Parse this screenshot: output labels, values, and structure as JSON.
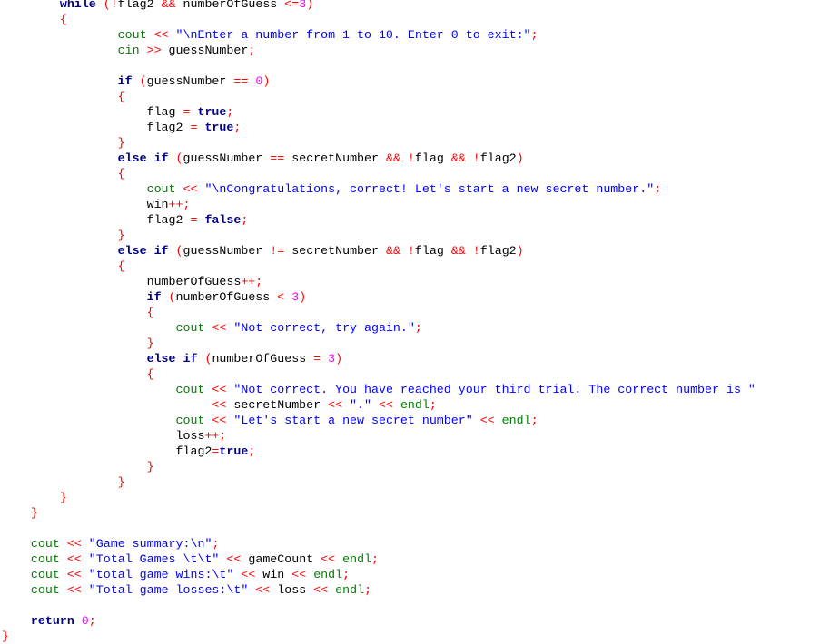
{
  "editor": {
    "language": "cpp",
    "colors": {
      "keyword": "#00008b",
      "stream": "#008000",
      "string": "#0000ff",
      "operator": "#ff0000",
      "number": "#ff00ff",
      "identifier": "#000000"
    },
    "lines": [
      {
        "indent": 8,
        "tokens": [
          [
            "kw",
            "while"
          ],
          [
            "id",
            " "
          ],
          [
            "op",
            "(!"
          ],
          [
            "id",
            "flag2 "
          ],
          [
            "op",
            "&&"
          ],
          [
            "id",
            " numberOfGuess "
          ],
          [
            "op",
            "<="
          ],
          [
            "num",
            "3"
          ],
          [
            "op",
            ")"
          ]
        ]
      },
      {
        "indent": 8,
        "tokens": [
          [
            "op",
            "{"
          ]
        ]
      },
      {
        "indent": 16,
        "tokens": [
          [
            "fn",
            "cout"
          ],
          [
            "id",
            " "
          ],
          [
            "op",
            "<<"
          ],
          [
            "id",
            " "
          ],
          [
            "str",
            "\"\\nEnter a number from 1 to 10. Enter 0 to exit:\""
          ],
          [
            "op",
            ";"
          ]
        ]
      },
      {
        "indent": 16,
        "tokens": [
          [
            "fn",
            "cin"
          ],
          [
            "id",
            " "
          ],
          [
            "op",
            ">>"
          ],
          [
            "id",
            " guessNumber"
          ],
          [
            "op",
            ";"
          ]
        ]
      },
      {
        "indent": 0,
        "tokens": []
      },
      {
        "indent": 16,
        "tokens": [
          [
            "kw",
            "if"
          ],
          [
            "id",
            " "
          ],
          [
            "op",
            "("
          ],
          [
            "id",
            "guessNumber "
          ],
          [
            "op",
            "=="
          ],
          [
            "id",
            " "
          ],
          [
            "num",
            "0"
          ],
          [
            "op",
            ")"
          ]
        ]
      },
      {
        "indent": 16,
        "tokens": [
          [
            "op",
            "{"
          ]
        ]
      },
      {
        "indent": 20,
        "tokens": [
          [
            "id",
            "flag "
          ],
          [
            "op",
            "="
          ],
          [
            "id",
            " "
          ],
          [
            "kw",
            "true"
          ],
          [
            "op",
            ";"
          ]
        ]
      },
      {
        "indent": 20,
        "tokens": [
          [
            "id",
            "flag2 "
          ],
          [
            "op",
            "="
          ],
          [
            "id",
            " "
          ],
          [
            "kw",
            "true"
          ],
          [
            "op",
            ";"
          ]
        ]
      },
      {
        "indent": 16,
        "tokens": [
          [
            "op",
            "}"
          ]
        ]
      },
      {
        "indent": 16,
        "tokens": [
          [
            "kw",
            "else"
          ],
          [
            "id",
            " "
          ],
          [
            "kw",
            "if"
          ],
          [
            "id",
            " "
          ],
          [
            "op",
            "("
          ],
          [
            "id",
            "guessNumber "
          ],
          [
            "op",
            "=="
          ],
          [
            "id",
            " secretNumber "
          ],
          [
            "op",
            "&&"
          ],
          [
            "id",
            " "
          ],
          [
            "op",
            "!"
          ],
          [
            "id",
            "flag "
          ],
          [
            "op",
            "&&"
          ],
          [
            "id",
            " "
          ],
          [
            "op",
            "!"
          ],
          [
            "id",
            "flag2"
          ],
          [
            "op",
            ")"
          ]
        ]
      },
      {
        "indent": 16,
        "tokens": [
          [
            "op",
            "{"
          ]
        ]
      },
      {
        "indent": 20,
        "tokens": [
          [
            "fn",
            "cout"
          ],
          [
            "id",
            " "
          ],
          [
            "op",
            "<<"
          ],
          [
            "id",
            " "
          ],
          [
            "str",
            "\"\\nCongratulations, correct! Let's start a new secret number.\""
          ],
          [
            "op",
            ";"
          ]
        ]
      },
      {
        "indent": 20,
        "tokens": [
          [
            "id",
            "win"
          ],
          [
            "op",
            "++;"
          ]
        ]
      },
      {
        "indent": 20,
        "tokens": [
          [
            "id",
            "flag2 "
          ],
          [
            "op",
            "="
          ],
          [
            "id",
            " "
          ],
          [
            "kw",
            "false"
          ],
          [
            "op",
            ";"
          ]
        ]
      },
      {
        "indent": 16,
        "tokens": [
          [
            "op",
            "}"
          ]
        ]
      },
      {
        "indent": 16,
        "tokens": [
          [
            "kw",
            "else"
          ],
          [
            "id",
            " "
          ],
          [
            "kw",
            "if"
          ],
          [
            "id",
            " "
          ],
          [
            "op",
            "("
          ],
          [
            "id",
            "guessNumber "
          ],
          [
            "op",
            "!="
          ],
          [
            "id",
            " secretNumber "
          ],
          [
            "op",
            "&&"
          ],
          [
            "id",
            " "
          ],
          [
            "op",
            "!"
          ],
          [
            "id",
            "flag "
          ],
          [
            "op",
            "&&"
          ],
          [
            "id",
            " "
          ],
          [
            "op",
            "!"
          ],
          [
            "id",
            "flag2"
          ],
          [
            "op",
            ")"
          ]
        ]
      },
      {
        "indent": 16,
        "tokens": [
          [
            "op",
            "{"
          ]
        ]
      },
      {
        "indent": 20,
        "tokens": [
          [
            "id",
            "numberOfGuess"
          ],
          [
            "op",
            "++;"
          ]
        ]
      },
      {
        "indent": 20,
        "tokens": [
          [
            "kw",
            "if"
          ],
          [
            "id",
            " "
          ],
          [
            "op",
            "("
          ],
          [
            "id",
            "numberOfGuess "
          ],
          [
            "op",
            "<"
          ],
          [
            "id",
            " "
          ],
          [
            "num",
            "3"
          ],
          [
            "op",
            ")"
          ]
        ]
      },
      {
        "indent": 20,
        "tokens": [
          [
            "op",
            "{"
          ]
        ]
      },
      {
        "indent": 24,
        "tokens": [
          [
            "fn",
            "cout"
          ],
          [
            "id",
            " "
          ],
          [
            "op",
            "<<"
          ],
          [
            "id",
            " "
          ],
          [
            "str",
            "\"Not correct, try again.\""
          ],
          [
            "op",
            ";"
          ]
        ]
      },
      {
        "indent": 20,
        "tokens": [
          [
            "op",
            "}"
          ]
        ]
      },
      {
        "indent": 20,
        "tokens": [
          [
            "kw",
            "else"
          ],
          [
            "id",
            " "
          ],
          [
            "kw",
            "if"
          ],
          [
            "id",
            " "
          ],
          [
            "op",
            "("
          ],
          [
            "id",
            "numberOfGuess "
          ],
          [
            "op",
            "="
          ],
          [
            "id",
            " "
          ],
          [
            "num",
            "3"
          ],
          [
            "op",
            ")"
          ]
        ]
      },
      {
        "indent": 20,
        "tokens": [
          [
            "op",
            "{"
          ]
        ]
      },
      {
        "indent": 24,
        "tokens": [
          [
            "fn",
            "cout"
          ],
          [
            "id",
            " "
          ],
          [
            "op",
            "<<"
          ],
          [
            "id",
            " "
          ],
          [
            "str",
            "\"Not correct. You have reached your third trial. The correct number is \""
          ]
        ]
      },
      {
        "indent": 29,
        "tokens": [
          [
            "op",
            "<<"
          ],
          [
            "id",
            " secretNumber "
          ],
          [
            "op",
            "<<"
          ],
          [
            "id",
            " "
          ],
          [
            "str",
            "\".\""
          ],
          [
            "id",
            " "
          ],
          [
            "op",
            "<<"
          ],
          [
            "id",
            " "
          ],
          [
            "fn",
            "endl"
          ],
          [
            "op",
            ";"
          ]
        ]
      },
      {
        "indent": 24,
        "tokens": [
          [
            "fn",
            "cout"
          ],
          [
            "id",
            " "
          ],
          [
            "op",
            "<<"
          ],
          [
            "id",
            " "
          ],
          [
            "str",
            "\"Let's start a new secret number\""
          ],
          [
            "id",
            " "
          ],
          [
            "op",
            "<<"
          ],
          [
            "id",
            " "
          ],
          [
            "fn",
            "endl"
          ],
          [
            "op",
            ";"
          ]
        ]
      },
      {
        "indent": 24,
        "tokens": [
          [
            "id",
            "loss"
          ],
          [
            "op",
            "++;"
          ]
        ]
      },
      {
        "indent": 24,
        "tokens": [
          [
            "id",
            "flag2"
          ],
          [
            "op",
            "="
          ],
          [
            "kw",
            "true"
          ],
          [
            "op",
            ";"
          ]
        ]
      },
      {
        "indent": 20,
        "tokens": [
          [
            "op",
            "}"
          ]
        ]
      },
      {
        "indent": 16,
        "tokens": [
          [
            "op",
            "}"
          ]
        ]
      },
      {
        "indent": 8,
        "tokens": [
          [
            "op",
            "}"
          ]
        ]
      },
      {
        "indent": 4,
        "tokens": [
          [
            "op",
            "}"
          ]
        ]
      },
      {
        "indent": 0,
        "tokens": []
      },
      {
        "indent": 4,
        "tokens": [
          [
            "fn",
            "cout"
          ],
          [
            "id",
            " "
          ],
          [
            "op",
            "<<"
          ],
          [
            "id",
            " "
          ],
          [
            "str",
            "\"Game summary:\\n\""
          ],
          [
            "op",
            ";"
          ]
        ]
      },
      {
        "indent": 4,
        "tokens": [
          [
            "fn",
            "cout"
          ],
          [
            "id",
            " "
          ],
          [
            "op",
            "<<"
          ],
          [
            "id",
            " "
          ],
          [
            "str",
            "\"Total Games \\t\\t\""
          ],
          [
            "id",
            " "
          ],
          [
            "op",
            "<<"
          ],
          [
            "id",
            " gameCount "
          ],
          [
            "op",
            "<<"
          ],
          [
            "id",
            " "
          ],
          [
            "fn",
            "endl"
          ],
          [
            "op",
            ";"
          ]
        ]
      },
      {
        "indent": 4,
        "tokens": [
          [
            "fn",
            "cout"
          ],
          [
            "id",
            " "
          ],
          [
            "op",
            "<<"
          ],
          [
            "id",
            " "
          ],
          [
            "str",
            "\"total game wins:\\t\""
          ],
          [
            "id",
            " "
          ],
          [
            "op",
            "<<"
          ],
          [
            "id",
            " win "
          ],
          [
            "op",
            "<<"
          ],
          [
            "id",
            " "
          ],
          [
            "fn",
            "endl"
          ],
          [
            "op",
            ";"
          ]
        ]
      },
      {
        "indent": 4,
        "tokens": [
          [
            "fn",
            "cout"
          ],
          [
            "id",
            " "
          ],
          [
            "op",
            "<<"
          ],
          [
            "id",
            " "
          ],
          [
            "str",
            "\"Total game losses:\\t\""
          ],
          [
            "id",
            " "
          ],
          [
            "op",
            "<<"
          ],
          [
            "id",
            " loss "
          ],
          [
            "op",
            "<<"
          ],
          [
            "id",
            " "
          ],
          [
            "fn",
            "endl"
          ],
          [
            "op",
            ";"
          ]
        ]
      },
      {
        "indent": 0,
        "tokens": []
      },
      {
        "indent": 4,
        "tokens": [
          [
            "kw",
            "return"
          ],
          [
            "id",
            " "
          ],
          [
            "num",
            "0"
          ],
          [
            "op",
            ";"
          ]
        ]
      },
      {
        "indent": 0,
        "tokens": [
          [
            "op",
            "}"
          ]
        ]
      }
    ]
  }
}
